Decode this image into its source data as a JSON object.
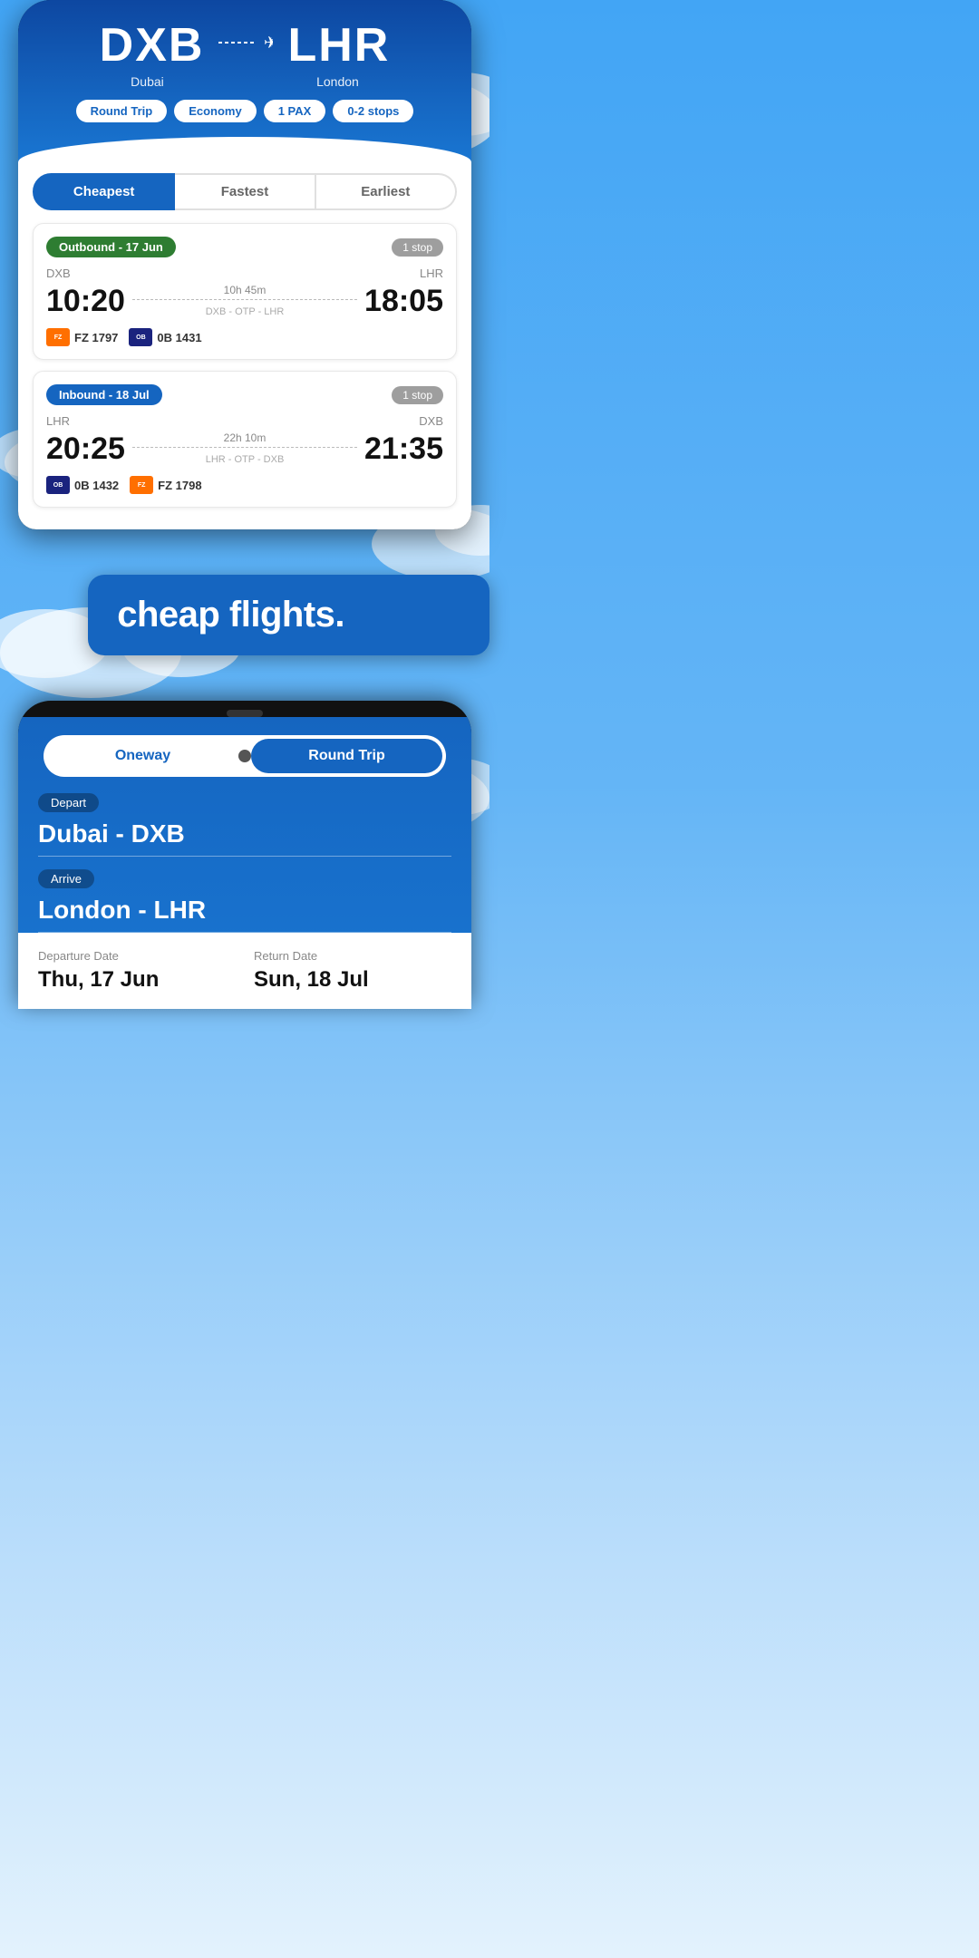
{
  "header": {
    "origin_code": "DXB",
    "origin_name": "Dubai",
    "destination_code": "LHR",
    "destination_name": "London",
    "trip_type": "Round Trip",
    "cabin": "Economy",
    "pax": "1 PAX",
    "stops": "0-2 stops"
  },
  "filter_tabs": {
    "cheapest": "Cheapest",
    "fastest": "Fastest",
    "earliest": "Earliest"
  },
  "outbound": {
    "label": "Outbound - 17 Jun",
    "stop_badge": "1 stop",
    "origin": "DXB",
    "destination": "LHR",
    "depart_time": "10:20",
    "arrive_time": "18:05",
    "duration": "10h 45m",
    "route": "DXB - OTP - LHR",
    "airline1_logo": "dubai",
    "airline1_code": "FZ 1797",
    "airline2_logo": "OB",
    "airline2_code": "0B 1431"
  },
  "inbound": {
    "label": "Inbound - 18 Jul",
    "stop_badge": "1 stop",
    "origin": "LHR",
    "destination": "DXB",
    "depart_time": "20:25",
    "arrive_time": "21:35",
    "duration": "22h 10m",
    "route": "LHR - OTP - DXB",
    "airline1_logo": "OB",
    "airline1_code": "0B 1432",
    "airline2_logo": "dubai",
    "airline2_code": "FZ 1798"
  },
  "promo": {
    "text": "cheap flights."
  },
  "search_form": {
    "oneway_label": "Oneway",
    "roundtrip_label": "Round Trip",
    "depart_label": "Depart",
    "depart_value": "Dubai - DXB",
    "arrive_label": "Arrive",
    "arrive_value": "London - LHR",
    "departure_date_label": "Departure Date",
    "departure_date_value": "Thu, 17 Jun",
    "return_date_label": "Return Date",
    "return_date_value": "Sun, 18 Jul"
  }
}
